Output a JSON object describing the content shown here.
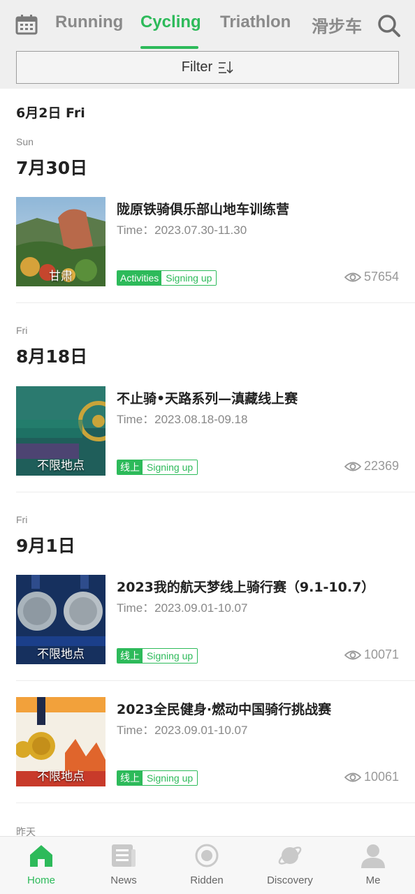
{
  "header": {
    "tabs": [
      {
        "label": "Running",
        "active": false
      },
      {
        "label": "Cycling",
        "active": true
      },
      {
        "label": "Triathlon",
        "active": false
      },
      {
        "label": "滑步车",
        "active": false
      }
    ],
    "filter_label": "Filter",
    "accent_color": "#2dba5a"
  },
  "content": {
    "today_date": "6月2日 Fri",
    "groups": [
      {
        "day": "Sun",
        "date": "7月30日",
        "events": [
          {
            "title": "陇原铁骑俱乐部山地车训练营",
            "time": "Time：2023.07.30-11.30",
            "location": "甘肃",
            "tag1": "Activities",
            "tag2": "Signing up",
            "views": "57654"
          }
        ]
      },
      {
        "day": "Fri",
        "date": "8月18日",
        "events": [
          {
            "title": "不止骑•天路系列—滇藏线上赛",
            "time": "Time：2023.08.18-09.18",
            "location": "不限地点",
            "tag1": "线上",
            "tag2": "Signing up",
            "views": "22369"
          }
        ]
      },
      {
        "day": "Fri",
        "date": "9月1日",
        "events": [
          {
            "title": "2023我的航天梦线上骑行赛（9.1-10.7）",
            "time": "Time：2023.09.01-10.07",
            "location": "不限地点",
            "tag1": "线上",
            "tag2": "Signing up",
            "views": "10071"
          },
          {
            "title": "2023全民健身·燃动中国骑行挑战赛",
            "time": "Time：2023.09.01-10.07",
            "location": "不限地点",
            "tag1": "线上",
            "tag2": "Signing up",
            "views": "10061"
          }
        ]
      },
      {
        "day": "昨天",
        "date": "",
        "events": []
      }
    ]
  },
  "bottom_nav": [
    {
      "label": "Home",
      "icon": "home-icon",
      "active": true
    },
    {
      "label": "News",
      "icon": "news-icon",
      "active": false
    },
    {
      "label": "Ridden",
      "icon": "ridden-icon",
      "active": false
    },
    {
      "label": "Discovery",
      "icon": "discovery-icon",
      "active": false
    },
    {
      "label": "Me",
      "icon": "me-icon",
      "active": false
    }
  ]
}
